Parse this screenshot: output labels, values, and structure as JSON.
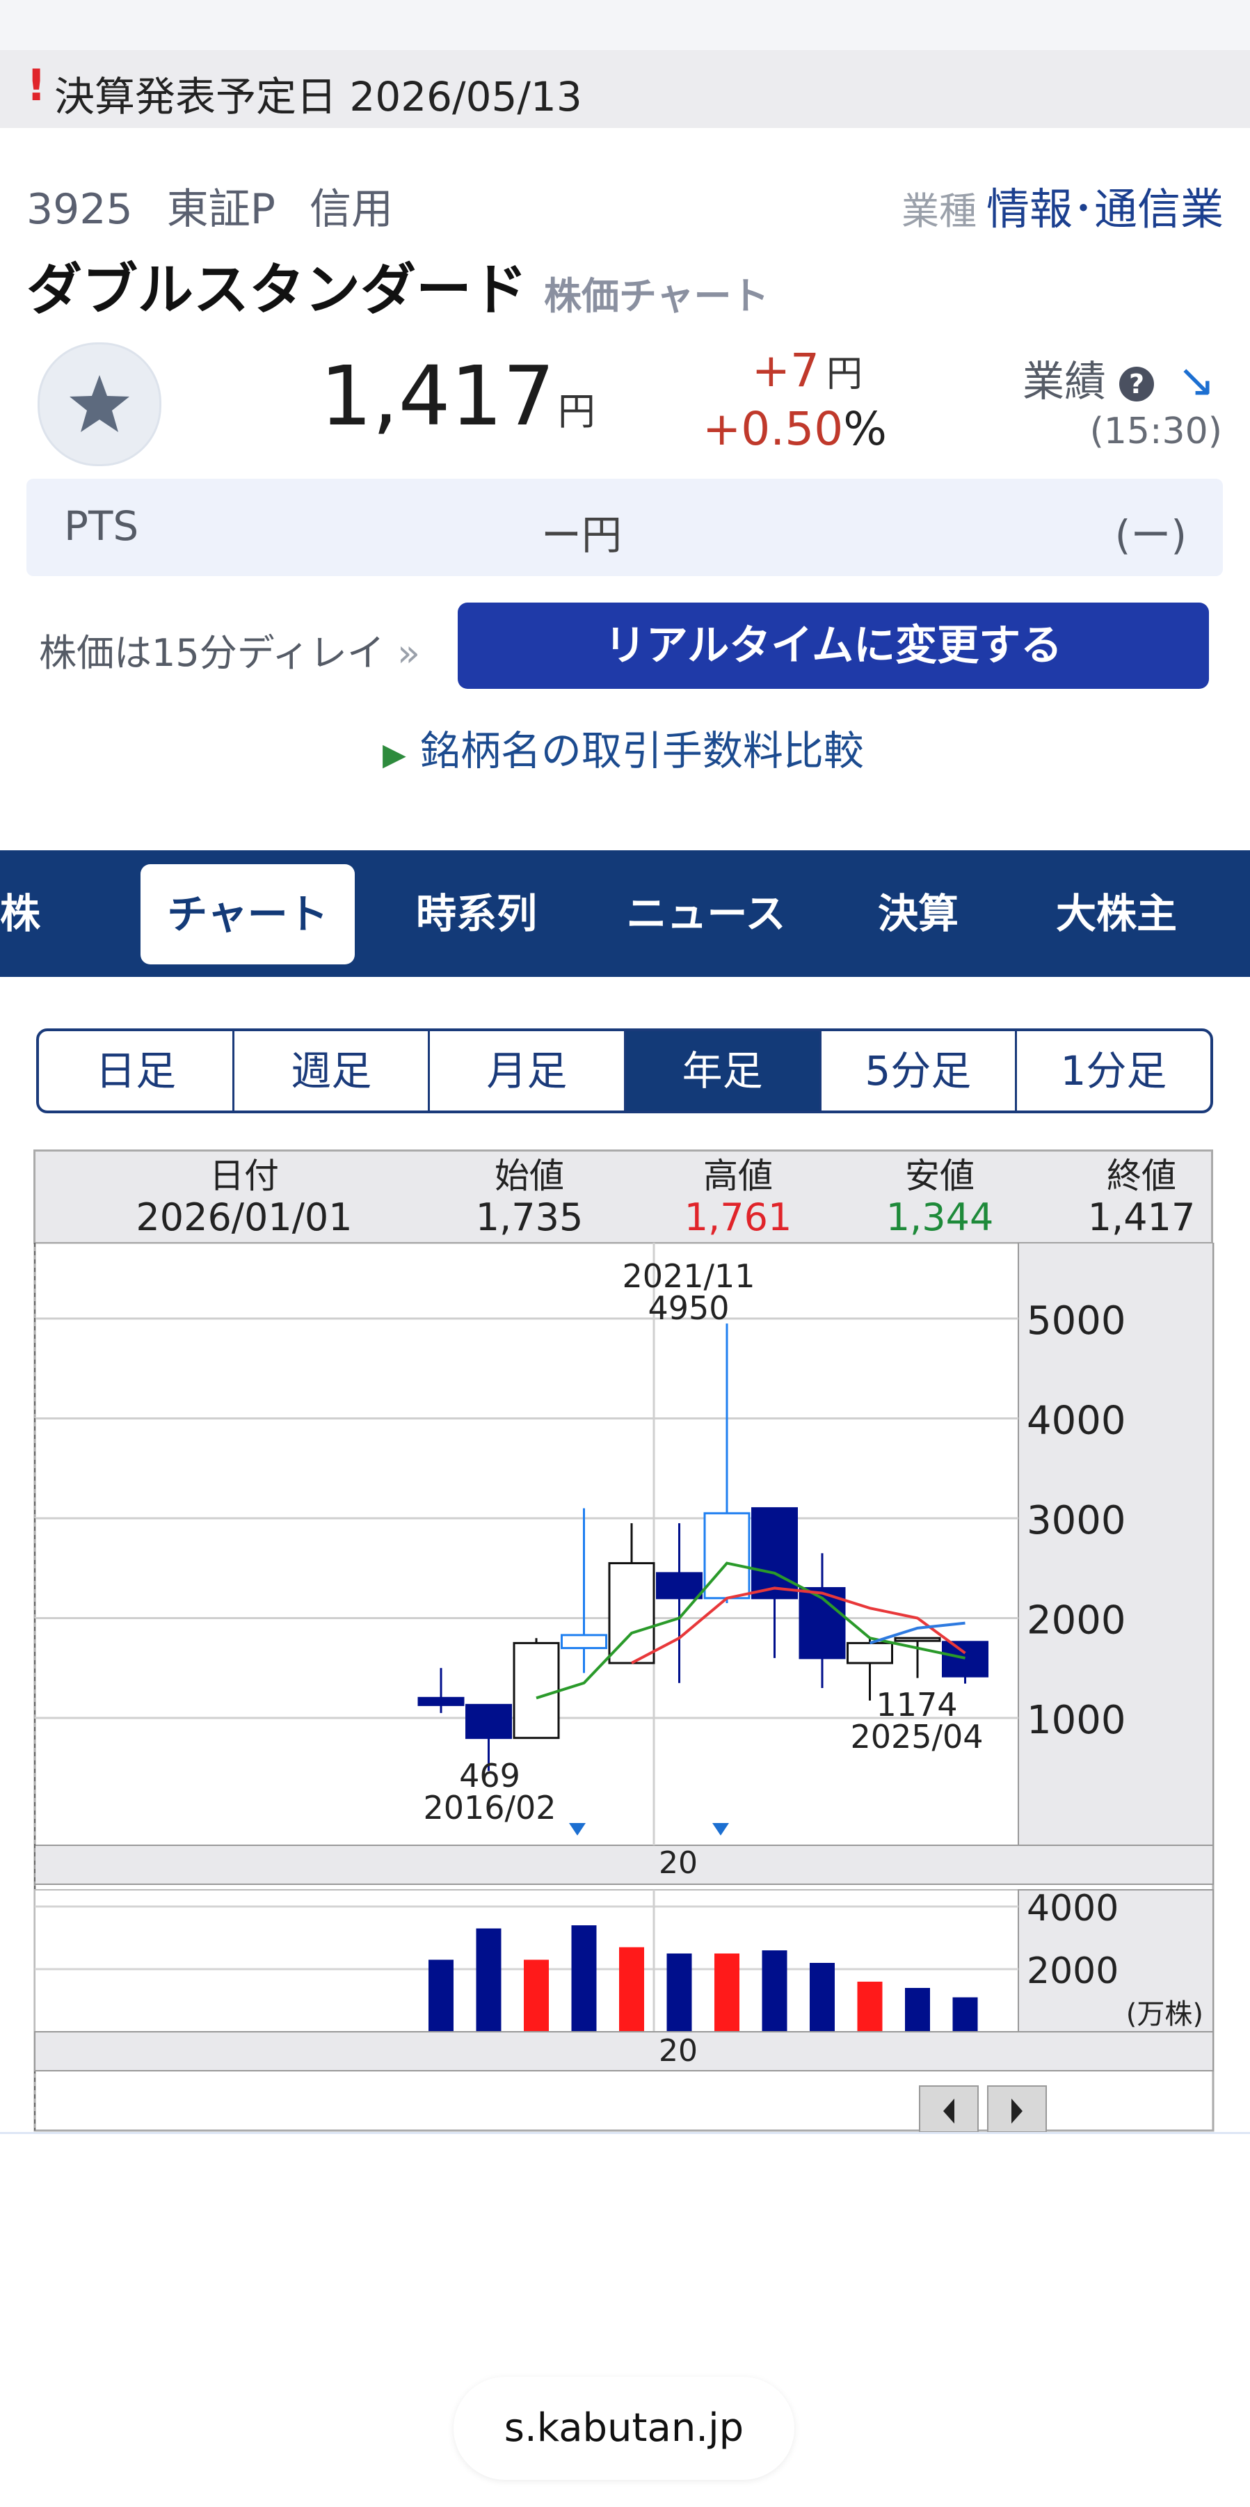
{
  "alert": {
    "mark": "!",
    "text": "決算発表予定日 2026/05/13"
  },
  "stock": {
    "code": "3925",
    "market": "東証P",
    "margin": "信用",
    "industry_label": "業種",
    "industry": "情報･通信業",
    "name": "ダブルスタンダード",
    "name_sub": "株価チャート",
    "price": "1,417",
    "price_unit": "円",
    "change": "+7",
    "change_unit": "円",
    "change_pct": "+0.50",
    "pct_sign": "%",
    "performance_label": "業績",
    "performance_help_icon": "?",
    "performance_arrow": "↘",
    "time": "(15:30)",
    "favorite_icon": "star-icon"
  },
  "pts": {
    "label": "PTS",
    "value": "ー円",
    "change": "(ー)"
  },
  "delay": {
    "text": "株価は15分ディレイ",
    "chevrons": "»",
    "realtime_button": "リアルタイムに変更する"
  },
  "compare_link": {
    "icon": "▶",
    "text": "銘柄名の取引手数料比較"
  },
  "nav": {
    "tabs": [
      {
        "label": "株価",
        "active": false
      },
      {
        "label": "チャート",
        "active": true
      },
      {
        "label": "時系列",
        "active": false
      },
      {
        "label": "ニュース",
        "active": false
      },
      {
        "label": "決算",
        "active": false
      },
      {
        "label": "大株主",
        "active": false
      }
    ]
  },
  "timeframes": [
    {
      "label": "日足",
      "active": false
    },
    {
      "label": "週足",
      "active": false
    },
    {
      "label": "月足",
      "active": false
    },
    {
      "label": "年足",
      "active": true
    },
    {
      "label": "5分足",
      "active": false
    },
    {
      "label": "1分足",
      "active": false
    }
  ],
  "ohlc": {
    "date_label": "日付",
    "date": "2026/01/01",
    "open_label": "始値",
    "open": "1,735",
    "high_label": "高値",
    "high": "1,761",
    "low_label": "安値",
    "low": "1,344",
    "close_label": "終値",
    "close": "1,417"
  },
  "colors": {
    "up_fill": "#ffffff",
    "down_fill": "#000f8c",
    "current_fill": "#1f7ff0",
    "high_text": "#e0242a",
    "low_text": "#1e8a3a",
    "ma_green": "#2a9a2a",
    "ma_red": "#e8383a",
    "ma_blue": "#2d7ae0",
    "nav_bg": "#133a78"
  },
  "chart_data": {
    "type": "candlestick",
    "period": "yearly",
    "candles": [
      {
        "open": 1200,
        "high": 1500,
        "low": 1050,
        "close": 1130
      },
      {
        "open": 1130,
        "high": 1130,
        "low": 469,
        "close": 800
      },
      {
        "open": 800,
        "high": 1800,
        "low": 800,
        "close": 1750
      },
      {
        "open": 1700,
        "high": 3100,
        "low": 1450,
        "close": 1830,
        "current": true
      },
      {
        "open": 1550,
        "high": 2950,
        "low": 1550,
        "close": 2550
      },
      {
        "open": 2450,
        "high": 2950,
        "low": 1350,
        "close": 2200
      },
      {
        "open": 2200,
        "high": 4950,
        "low": 2150,
        "close": 3050,
        "current": true
      },
      {
        "open": 3100,
        "high": 3100,
        "low": 1600,
        "close": 2200
      },
      {
        "open": 2300,
        "high": 2650,
        "low": 1300,
        "close": 1600
      },
      {
        "open": 1550,
        "high": 1800,
        "low": 1174,
        "close": 1750
      },
      {
        "open": 1800,
        "high": 1800,
        "low": 1400,
        "close": 1800
      },
      {
        "open": 1761,
        "high": 1761,
        "low": 1344,
        "close": 1417
      }
    ],
    "moving_averages": [
      {
        "name": "green",
        "values": [
          null,
          null,
          1200,
          1350,
          1850,
          2000,
          2550,
          2450,
          2200,
          1800,
          1700,
          1600
        ]
      },
      {
        "name": "red",
        "values": [
          null,
          null,
          null,
          null,
          1550,
          1800,
          2200,
          2300,
          2250,
          2100,
          2000,
          1650
        ]
      },
      {
        "name": "blue",
        "values": [
          null,
          null,
          null,
          null,
          null,
          null,
          null,
          null,
          null,
          1750,
          1900,
          1950
        ]
      }
    ],
    "y_ticks": [
      1000,
      2000,
      3000,
      4000,
      5000
    ],
    "annotations": [
      {
        "text": "2021/11",
        "value": "4950"
      },
      {
        "text": "469",
        "value": "2016/02"
      },
      {
        "text": "1174",
        "value": "2025/04"
      }
    ],
    "x_label": "20",
    "volume": {
      "values": [
        2300,
        3300,
        2300,
        3400,
        2700,
        2500,
        2500,
        2600,
        2200,
        1600,
        1400,
        1100
      ],
      "colors": [
        "up",
        "up",
        "down",
        "up",
        "down",
        "up",
        "down",
        "up",
        "up",
        "down",
        "up",
        "up"
      ],
      "ticks": [
        "4000",
        "2000"
      ],
      "unit": "(万株)",
      "x_label": "20"
    }
  },
  "url_bar": {
    "url": "s.kabutan.jp"
  }
}
